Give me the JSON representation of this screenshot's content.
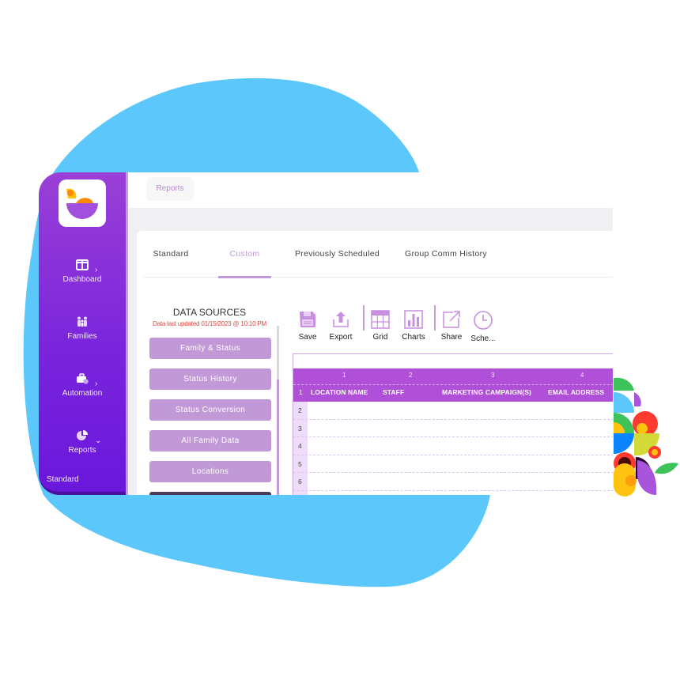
{
  "colors": {
    "blob": "#5cc7fa",
    "sidebar_top": "#9a3fd6",
    "sidebar_bottom": "#6a17dc",
    "accent": "#c199d6",
    "grid_header": "#b04fd8",
    "warning_text": "#e0463d"
  },
  "sidebar": {
    "logo": "app-logo",
    "items": [
      {
        "label": "Dashboard",
        "icon": "dashboard-icon",
        "chevron": "›"
      },
      {
        "label": "Families",
        "icon": "family-icon",
        "chevron": ""
      },
      {
        "label": "Automation",
        "icon": "briefcase-clock-icon",
        "chevron": "›"
      },
      {
        "label": "Reports",
        "icon": "pie-chart-icon",
        "chevron": "⌄"
      }
    ],
    "sub_item": "Standard"
  },
  "topbar": {
    "breadcrumb": "Reports"
  },
  "tabs": [
    {
      "label": "Standard",
      "active": false
    },
    {
      "label": "Custom",
      "active": true
    },
    {
      "label": "Previously Scheduled",
      "active": false
    },
    {
      "label": "Group Comm History",
      "active": false
    }
  ],
  "data_sources": {
    "title": "DATA SOURCES",
    "updated": "Data last updated 01/15/2023 @ 10:10 PM",
    "items": [
      "Family & Status",
      "Status History",
      "Status Conversion",
      "All Family Data",
      "Locations",
      ""
    ]
  },
  "toolbar": {
    "save": "Save",
    "export": "Export",
    "grid": "Grid",
    "charts": "Charts",
    "share": "Share",
    "schedule": "Sche..."
  },
  "grid": {
    "column_numbers": [
      "1",
      "2",
      "3",
      "4"
    ],
    "header_row_number": "1",
    "columns": [
      "LOCATION NAME",
      "STAFF",
      "MARKETING CAMPAIGN(S)",
      "EMAIL ADDRESS"
    ],
    "row_numbers": [
      "2",
      "3",
      "4",
      "5",
      "6"
    ]
  }
}
